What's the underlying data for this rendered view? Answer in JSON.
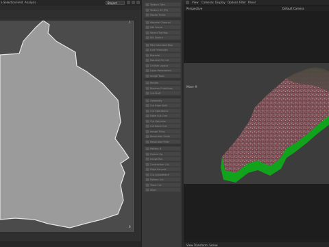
{
  "left_menu": {
    "items": [
      "a Selection",
      "Field",
      "Analysis"
    ]
  },
  "project_select": {
    "value": "Project"
  },
  "uv_axis": {
    "top_right": "1",
    "bottom_right": "0",
    "bottom_left": "0"
  },
  "texture_list": {
    "rows": [
      "Texture Files",
      "Texture 05 (Pt)",
      "Decim Tickle",
      "Material Channel",
      "Nth Scene",
      "Kinect Tra Map",
      "Kth Sketch",
      "Mtd Extended Map",
      "Line Primitives",
      "Material",
      "Material Fin Cut",
      "Crt Mat Layout",
      "Layer Parameters",
      "Image Tools",
      "Render",
      "Boolean Primitives",
      "Cut Stuff",
      "Geometry",
      "Cut Edge Split",
      "Cut Operations",
      "Edge Cull Line",
      "Cut Optimize",
      "Cut Bevel Cut",
      "Image Tiling",
      "Resolution Scale",
      "Resolution Filter",
      "Pattern B",
      "Extend Op",
      "Image Rot",
      "Contraction Cut",
      "Edge Extrude",
      "Cut Adjustment",
      "Pattern Cut",
      "Trace Cut",
      "Align"
    ]
  },
  "right_menu": {
    "items": [
      "View",
      "Cameras",
      "Display",
      "Options",
      "Filter",
      "Panel"
    ]
  },
  "viewport": {
    "label": "Perspective",
    "camera": "Default Camera",
    "move_label": "Move ®",
    "status": "View Transform: Scene"
  },
  "colors": {
    "uv_shell": "#9b9b9b",
    "uv_outline": "#e6e6e6",
    "terrain_base": "#7a4a52",
    "terrain_side": "#12a31c"
  }
}
